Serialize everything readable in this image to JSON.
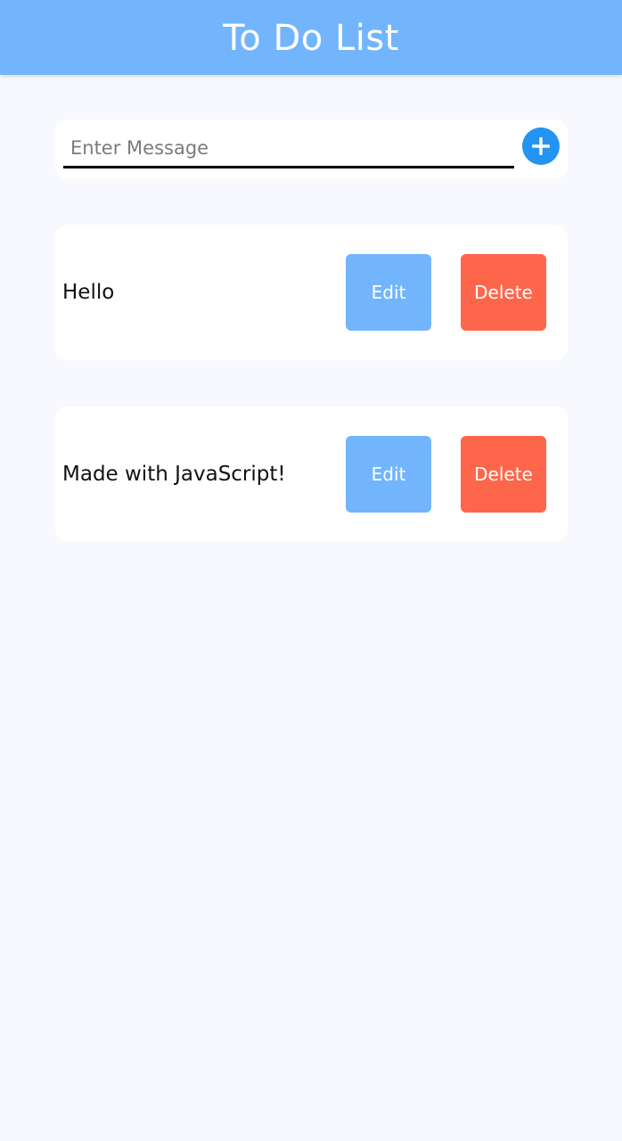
{
  "app": {
    "title": "To Do List"
  },
  "input": {
    "placeholder": "Enter Message",
    "value": "",
    "add_icon": "plus-icon"
  },
  "tasks": [
    {
      "text": "Hello",
      "edit_label": "Edit",
      "delete_label": "Delete"
    },
    {
      "text": "Made with JavaScript!",
      "edit_label": "Edit",
      "delete_label": "Delete"
    }
  ],
  "colors": {
    "app_bar": "#72b5fd",
    "background": "#f7f9fe",
    "add_button": "#2394f2",
    "edit_button": "#72b5fd",
    "delete_button": "#fe664b"
  }
}
